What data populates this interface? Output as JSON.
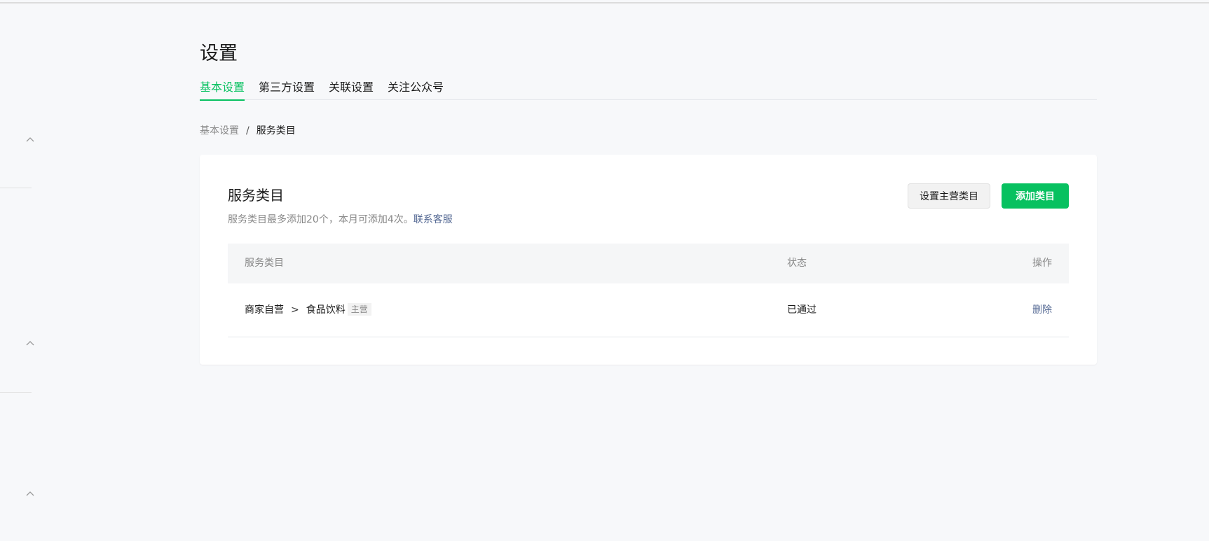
{
  "page": {
    "title": "设置"
  },
  "tabs": [
    {
      "label": "基本设置",
      "active": true
    },
    {
      "label": "第三方设置",
      "active": false
    },
    {
      "label": "关联设置",
      "active": false
    },
    {
      "label": "关注公众号",
      "active": false
    }
  ],
  "breadcrumb": {
    "parent": "基本设置",
    "separator": "/",
    "current": "服务类目"
  },
  "card": {
    "title": "服务类目",
    "description": "服务类目最多添加20个，本月可添加4次。",
    "contact_link": "联系客服",
    "set_main_button": "设置主营类目",
    "add_button": "添加类目"
  },
  "table": {
    "headers": {
      "category": "服务类目",
      "status": "状态",
      "action": "操作"
    },
    "rows": [
      {
        "parent_category": "商家自营",
        "separator": ">",
        "category": "食品饮料",
        "tag": "主营",
        "status": "已通过",
        "action": "删除"
      }
    ]
  },
  "sidebar": {
    "icons": [
      "chevron-up-icon",
      "chevron-up-icon",
      "chevron-up-icon"
    ]
  },
  "colors": {
    "accent": "#07c160",
    "link": "#576b95",
    "muted": "#888888",
    "background": "#f7f8fa"
  }
}
